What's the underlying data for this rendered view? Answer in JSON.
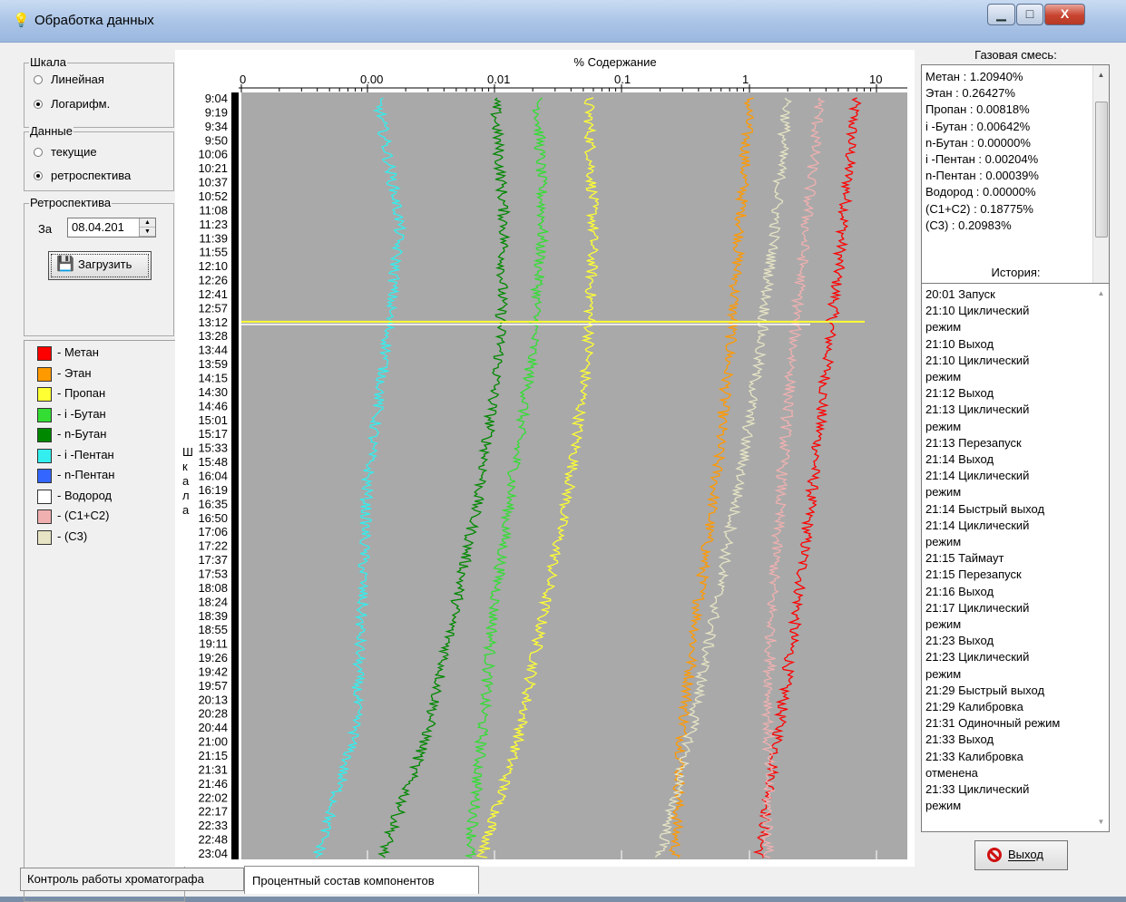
{
  "window": {
    "title": "Обработка данных",
    "buttons": {
      "minimize": "▁",
      "maximize": "□",
      "close": "X"
    }
  },
  "left": {
    "scale_group": {
      "legend": "Шкала",
      "options": [
        "Линейная",
        "Логарифм."
      ],
      "selected": "Логарифм."
    },
    "data_group": {
      "legend": "Данные",
      "options": [
        "текущие",
        "ретроспектива"
      ],
      "selected": "ретроспектива"
    },
    "retro_group": {
      "legend": "Ретроспектива",
      "date_label": "За",
      "date_value": "08.04.201",
      "load_button": "Загрузить"
    },
    "legend_items": [
      {
        "label": "- Метан",
        "color": "#ff0000"
      },
      {
        "label": "- Этан",
        "color": "#ff9900"
      },
      {
        "label": "- Пропан",
        "color": "#ffff33"
      },
      {
        "label": "- i -Бутан",
        "color": "#33dd33"
      },
      {
        "label": "- n-Бутан",
        "color": "#008800"
      },
      {
        "label": "- i -Пентан",
        "color": "#33eeee"
      },
      {
        "label": "- n-Пентан",
        "color": "#3366ff"
      },
      {
        "label": "- Водород",
        "color": "#ffffff"
      },
      {
        "label": "- (C1+C2)",
        "color": "#f0b0b0"
      },
      {
        "label": "- (C3)",
        "color": "#e6e4c4"
      }
    ]
  },
  "chart": {
    "title": "% Содержание",
    "scale_vertical_label": "Шкала",
    "x_ticks": [
      "0",
      "0.00",
      "0.01",
      "0.1",
      "1",
      "10"
    ],
    "time_ticks": [
      "9:04",
      "9:19",
      "9:34",
      "9:50",
      "10:06",
      "10:21",
      "10:37",
      "10:52",
      "11:08",
      "11:23",
      "11:39",
      "11:55",
      "12:10",
      "12:26",
      "12:41",
      "12:57",
      "13:12",
      "13:28",
      "13:44",
      "13:59",
      "14:15",
      "14:30",
      "14:46",
      "15:01",
      "15:17",
      "15:33",
      "15:48",
      "16:04",
      "16:19",
      "16:35",
      "16:50",
      "17:06",
      "17:22",
      "17:37",
      "17:53",
      "18:08",
      "18:24",
      "18:39",
      "18:55",
      "19:11",
      "19:26",
      "19:42",
      "19:57",
      "20:13",
      "20:28",
      "20:44",
      "21:00",
      "21:15",
      "21:31",
      "21:46",
      "22:02",
      "22:17",
      "22:33",
      "22:48",
      "23:04"
    ],
    "background": "#a9a9a9"
  },
  "chart_data": {
    "type": "line",
    "x_scale": "log",
    "xlabel": "% Содержание",
    "x_tick_values": [
      0.0001,
      0.001,
      0.01,
      0.1,
      1,
      10
    ],
    "time_range": [
      "9:04",
      "23:04"
    ],
    "series": [
      {
        "name": "Метан",
        "color": "#ff0000",
        "values": [
          6.8,
          5.5,
          4.2,
          3.2,
          2.4,
          1.7,
          1.2
        ]
      },
      {
        "name": "Этан",
        "color": "#ff9900",
        "values": [
          1.0,
          0.85,
          0.7,
          0.55,
          0.4,
          0.3,
          0.26
        ]
      },
      {
        "name": "Пропан",
        "color": "#ffff33",
        "values": [
          0.055,
          0.06,
          0.055,
          0.04,
          0.025,
          0.016,
          0.008
        ]
      },
      {
        "name": "i -Бутан",
        "color": "#33dd33",
        "values": [
          0.022,
          0.024,
          0.02,
          0.014,
          0.01,
          0.008,
          0.0064
        ]
      },
      {
        "name": "n-Бутан",
        "color": "#008800",
        "values": [
          0.01,
          0.012,
          0.011,
          0.008,
          0.005,
          0.003,
          0.0013
        ]
      },
      {
        "name": "i -Пентан",
        "color": "#33eeee",
        "values": [
          0.0012,
          0.0018,
          0.0014,
          0.001,
          0.0009,
          0.0008,
          0.0004
        ]
      },
      {
        "name": "(C1+C2)",
        "color": "#f0b0b0",
        "values": [
          3.6,
          2.8,
          2.2,
          1.8,
          1.5,
          1.4,
          1.4
        ]
      },
      {
        "name": "(C3)",
        "color": "#e6e4c4",
        "values": [
          2.0,
          1.6,
          1.2,
          0.85,
          0.55,
          0.35,
          0.2
        ]
      }
    ]
  },
  "right": {
    "gas_header": "Газовая смесь:",
    "gas_lines": [
      "Метан : 1.20940%",
      "Этан : 0.26427%",
      "Пропан : 0.00818%",
      "i -Бутан : 0.00642%",
      "n-Бутан : 0.00000%",
      "i -Пентан : 0.00204%",
      "n-Пентан : 0.00039%",
      "Водород : 0.00000%",
      "(C1+C2) : 0.18775%",
      "(C3) : 0.20983%"
    ],
    "history_header": "История:",
    "history_lines": [
      "20:01 Запуск",
      "21:10 Циклический",
      "режим",
      "21:10 Выход",
      "21:10 Циклический",
      "режим",
      "21:12 Выход",
      "21:13 Циклический",
      "режим",
      "21:13 Перезапуск",
      "21:14 Выход",
      "21:14 Циклический",
      "режим",
      "21:14 Быстрый выход",
      "21:14 Циклический",
      "режим",
      "21:15 Таймаут",
      "21:15 Перезапуск",
      "21:16 Выход",
      "21:17 Циклический",
      "режим",
      "21:23 Выход",
      "21:23 Циклический",
      "режим",
      "21:29 Быстрый выход",
      "21:29 Калибровка",
      "21:31 Одиночный режим",
      "21:33 Выход",
      "21:33 Калибровка",
      "отменена",
      "21:33 Циклический",
      "режим"
    ],
    "exit_button": "Выход"
  },
  "tabs": [
    {
      "label": "Контроль работы хроматографа",
      "active": false
    },
    {
      "label": "Процентный состав компонентов",
      "active": true
    }
  ]
}
